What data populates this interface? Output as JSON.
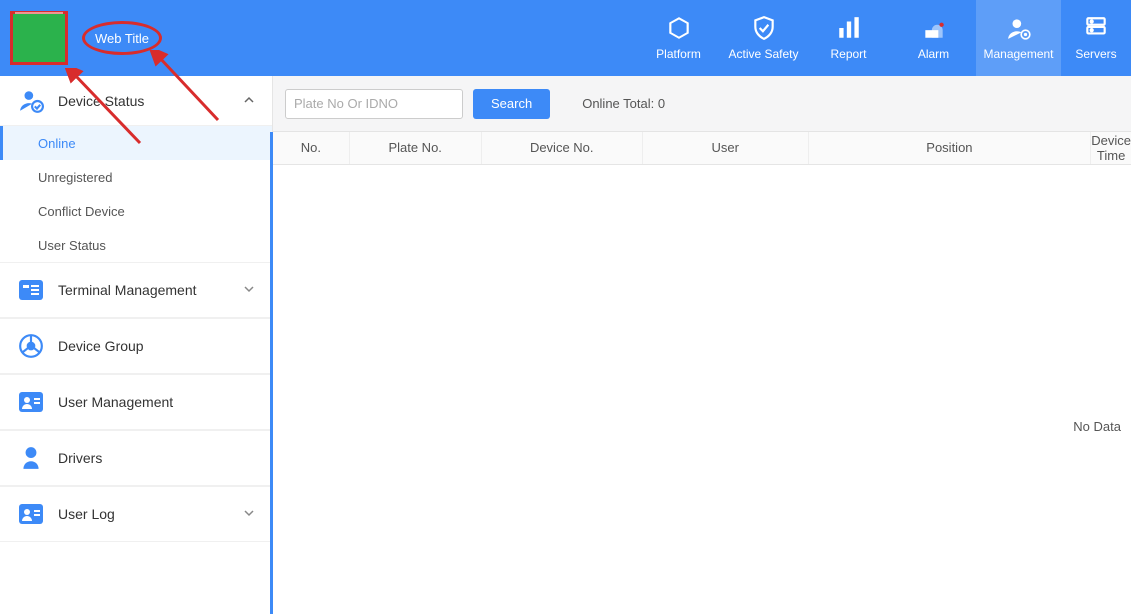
{
  "header": {
    "web_title": "Web Title",
    "nav": [
      {
        "label": "Platform",
        "icon": "platform"
      },
      {
        "label": "Active Safety",
        "icon": "shield"
      },
      {
        "label": "Report",
        "icon": "bar"
      },
      {
        "label": "Alarm",
        "icon": "alarm"
      },
      {
        "label": "Management",
        "icon": "mgmt"
      },
      {
        "label": "Servers",
        "icon": "server"
      }
    ],
    "active_nav": 4
  },
  "sidebar": {
    "device_status": {
      "label": "Device Status",
      "expanded": true,
      "items": [
        {
          "label": "Online",
          "active": true
        },
        {
          "label": "Unregistered"
        },
        {
          "label": "Conflict Device"
        },
        {
          "label": "User Status"
        }
      ]
    },
    "sections": [
      {
        "label": "Terminal Management",
        "chevron": true,
        "icon": "terminal"
      },
      {
        "label": "Device Group",
        "icon": "wheel"
      },
      {
        "label": "User Management",
        "icon": "user-card"
      },
      {
        "label": "Drivers",
        "icon": "driver"
      },
      {
        "label": "User Log",
        "chevron": true,
        "icon": "user-card"
      }
    ]
  },
  "search": {
    "placeholder": "Plate No Or IDNO",
    "button": "Search",
    "online_total_label": "Online Total:",
    "online_total_value": "0"
  },
  "table": {
    "columns": [
      "No.",
      "Plate No.",
      "Device No.",
      "User",
      "Position",
      "Device Time"
    ],
    "no_data": "No Data"
  }
}
